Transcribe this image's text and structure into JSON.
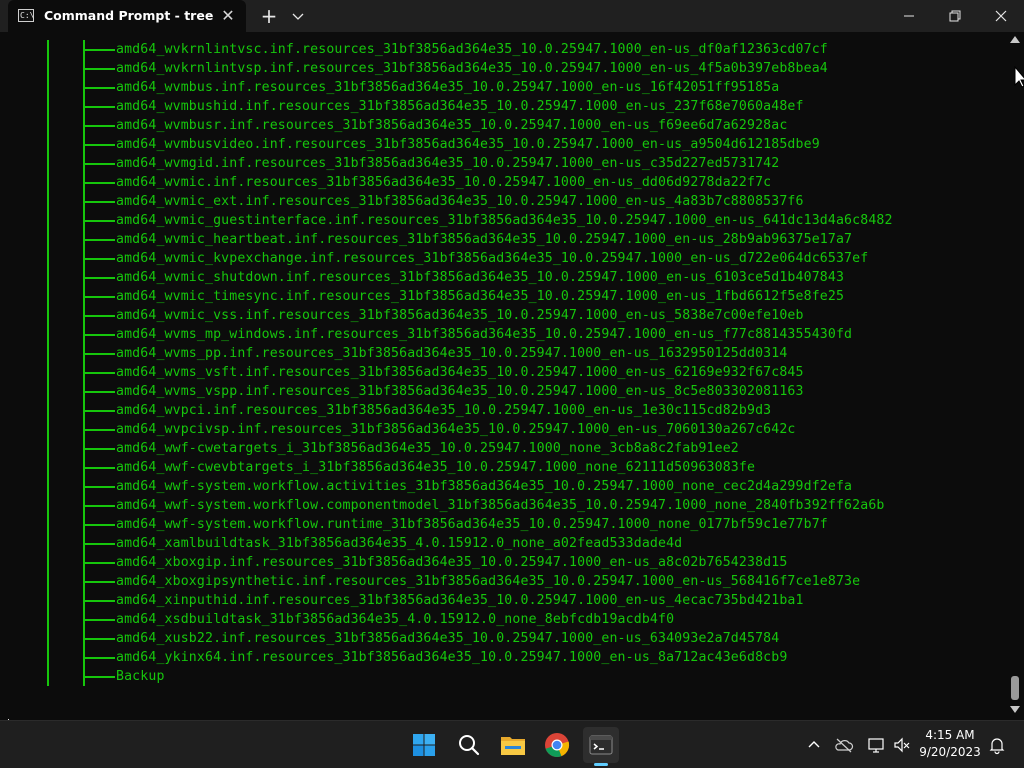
{
  "window": {
    "tab_title": "Command Prompt - tree",
    "tab_icon_text": "C:\\",
    "close_tab_glyph": "✕",
    "new_tab_glyph": "+",
    "dropdown_glyph": "⌄",
    "minimize_glyph": "—",
    "maximize_glyph": "❐",
    "close_window_glyph": "✕"
  },
  "console": {
    "lines": [
      "amd64_wvkrnlintvsc.inf.resources_31bf3856ad364e35_10.0.25947.1000_en-us_df0af12363cd07cf",
      "amd64_wvkrnlintvsp.inf.resources_31bf3856ad364e35_10.0.25947.1000_en-us_4f5a0b397eb8bea4",
      "amd64_wvmbus.inf.resources_31bf3856ad364e35_10.0.25947.1000_en-us_16f42051ff95185a",
      "amd64_wvmbushid.inf.resources_31bf3856ad364e35_10.0.25947.1000_en-us_237f68e7060a48ef",
      "amd64_wvmbusr.inf.resources_31bf3856ad364e35_10.0.25947.1000_en-us_f69ee6d7a62928ac",
      "amd64_wvmbusvideo.inf.resources_31bf3856ad364e35_10.0.25947.1000_en-us_a9504d612185dbe9",
      "amd64_wvmgid.inf.resources_31bf3856ad364e35_10.0.25947.1000_en-us_c35d227ed5731742",
      "amd64_wvmic.inf.resources_31bf3856ad364e35_10.0.25947.1000_en-us_dd06d9278da22f7c",
      "amd64_wvmic_ext.inf.resources_31bf3856ad364e35_10.0.25947.1000_en-us_4a83b7c8808537f6",
      "amd64_wvmic_guestinterface.inf.resources_31bf3856ad364e35_10.0.25947.1000_en-us_641dc13d4a6c8482",
      "amd64_wvmic_heartbeat.inf.resources_31bf3856ad364e35_10.0.25947.1000_en-us_28b9ab96375e17a7",
      "amd64_wvmic_kvpexchange.inf.resources_31bf3856ad364e35_10.0.25947.1000_en-us_d722e064dc6537ef",
      "amd64_wvmic_shutdown.inf.resources_31bf3856ad364e35_10.0.25947.1000_en-us_6103ce5d1b407843",
      "amd64_wvmic_timesync.inf.resources_31bf3856ad364e35_10.0.25947.1000_en-us_1fbd6612f5e8fe25",
      "amd64_wvmic_vss.inf.resources_31bf3856ad364e35_10.0.25947.1000_en-us_5838e7c00efe10eb",
      "amd64_wvms_mp_windows.inf.resources_31bf3856ad364e35_10.0.25947.1000_en-us_f77c8814355430fd",
      "amd64_wvms_pp.inf.resources_31bf3856ad364e35_10.0.25947.1000_en-us_1632950125dd0314",
      "amd64_wvms_vsft.inf.resources_31bf3856ad364e35_10.0.25947.1000_en-us_62169e932f67c845",
      "amd64_wvms_vspp.inf.resources_31bf3856ad364e35_10.0.25947.1000_en-us_8c5e803302081163",
      "amd64_wvpci.inf.resources_31bf3856ad364e35_10.0.25947.1000_en-us_1e30c115cd82b9d3",
      "amd64_wvpcivsp.inf.resources_31bf3856ad364e35_10.0.25947.1000_en-us_7060130a267c642c",
      "amd64_wwf-cwetargets_i_31bf3856ad364e35_10.0.25947.1000_none_3cb8a8c2fab91ee2",
      "amd64_wwf-cwevbtargets_i_31bf3856ad364e35_10.0.25947.1000_none_62111d50963083fe",
      "amd64_wwf-system.workflow.activities_31bf3856ad364e35_10.0.25947.1000_none_cec2d4a299df2efa",
      "amd64_wwf-system.workflow.componentmodel_31bf3856ad364e35_10.0.25947.1000_none_2840fb392ff62a6b",
      "amd64_wwf-system.workflow.runtime_31bf3856ad364e35_10.0.25947.1000_none_0177bf59c1e77b7f",
      "amd64_xamlbuildtask_31bf3856ad364e35_4.0.15912.0_none_a02fead533dade4d",
      "amd64_xboxgip.inf.resources_31bf3856ad364e35_10.0.25947.1000_en-us_a8c02b7654238d15",
      "amd64_xboxgipsynthetic.inf.resources_31bf3856ad364e35_10.0.25947.1000_en-us_568416f7ce1e873e",
      "amd64_xinputhid.inf.resources_31bf3856ad364e35_10.0.25947.1000_en-us_4ecac735bd421ba1",
      "amd64_xsdbuildtask_31bf3856ad364e35_4.0.15912.0_none_8ebfcdb19acdb4f0",
      "amd64_xusb22.inf.resources_31bf3856ad364e35_10.0.25947.1000_en-us_634093e2a7d45784",
      "amd64_ykinx64.inf.resources_31bf3856ad364e35_10.0.25947.1000_en-us_8a712ac43e6d8cb9",
      "Backup"
    ],
    "text_color": "#16c60c",
    "background_color": "#0c0c0c"
  },
  "taskbar": {
    "pinned": [
      "start-icon",
      "search-icon",
      "file-explorer-icon",
      "chrome-icon",
      "terminal-icon"
    ],
    "tray_icons": [
      "chevron-up-icon",
      "onedrive-icon",
      "network-icon",
      "volume-muted-icon",
      "notifications-icon"
    ],
    "time": "4:15 AM",
    "date": "9/20/2023",
    "active_indicator_color": "#60cdff"
  }
}
